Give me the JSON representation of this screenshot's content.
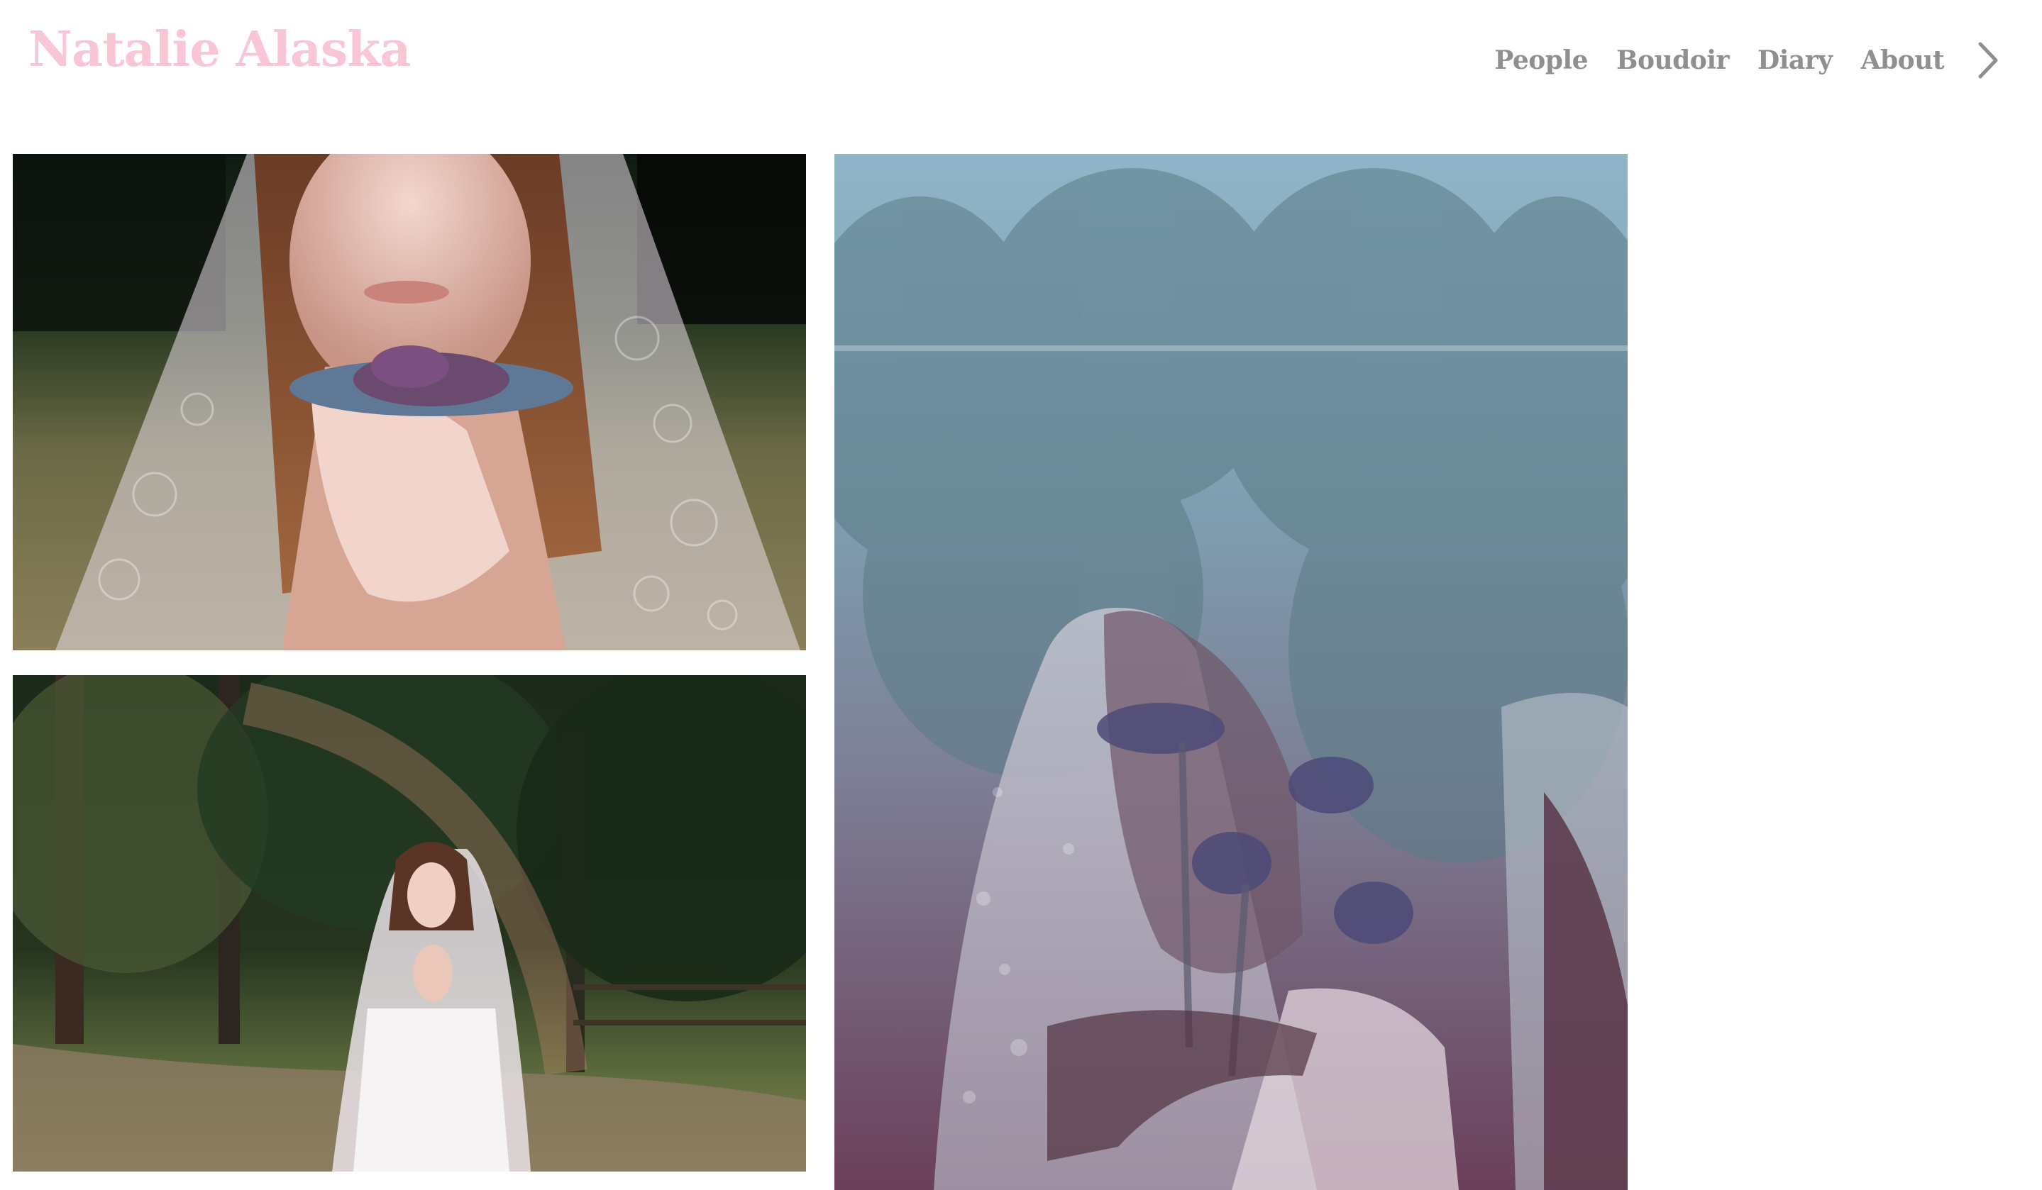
{
  "site": {
    "title": "Natalie Alaska"
  },
  "nav": {
    "items": [
      {
        "label": "People"
      },
      {
        "label": "Boudoir"
      },
      {
        "label": "Diary"
      },
      {
        "label": "About"
      }
    ],
    "next_icon": "chevron-right-icon"
  },
  "colors": {
    "title": "#f9c6d4",
    "nav_text": "#8f8f8f",
    "background": "#ffffff"
  },
  "gallery": {
    "photos": [
      {
        "subject": "veiled-woman-holding-flower-closeup"
      },
      {
        "subject": "veiled-woman-in-forest-clearing"
      },
      {
        "subject": "double-exposure-veiled-woman-and-trees"
      }
    ]
  }
}
